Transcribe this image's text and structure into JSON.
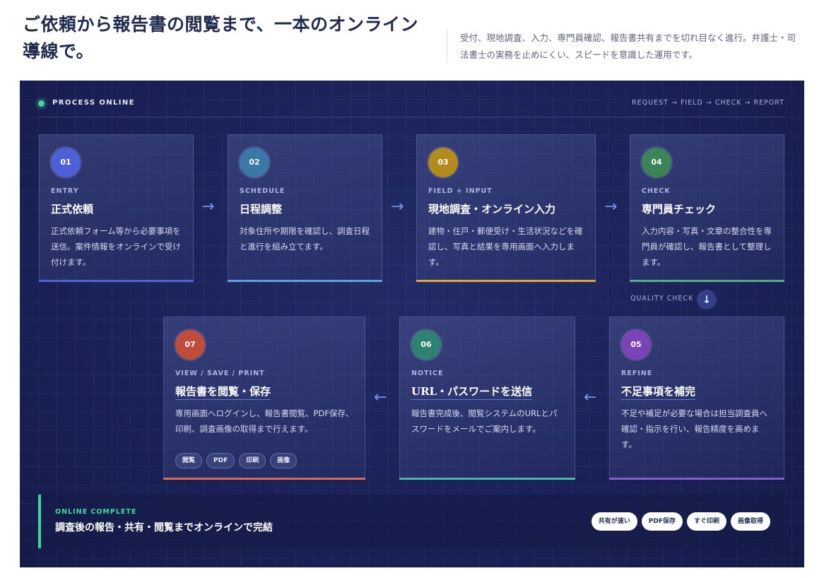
{
  "header": {
    "title": "ご依頼から報告書の閲覧まで、一本のオンライン導線で。",
    "description": "受付、現地調査、入力、専門員確認、報告書共有までを切れ目なく進行。弁護士・司法書士の実務を止めにくい、スピードを意識した運用です。"
  },
  "panel": {
    "label": "PROCESS ONLINE",
    "flow": "REQUEST → FIELD → CHECK → REPORT",
    "quality_check": "QUALITY CHECK",
    "arrow_right": "→",
    "arrow_left": "←",
    "arrow_down": "↓"
  },
  "steps": [
    {
      "num": "01",
      "tag": "ENTRY",
      "title": "正式依頼",
      "desc": "正式依頼フォーム等から必要事項を送信。案件情報をオンラインで受け付けます。",
      "color": "#4f5fd8"
    },
    {
      "num": "02",
      "tag": "SCHEDULE",
      "title": "日程調整",
      "desc": "対象住所や期限を確認し、調査日程と進行を組み立てます。",
      "color": "#3a78a8"
    },
    {
      "num": "03",
      "tag": "FIELD + INPUT",
      "title": "現地調査・オンライン入力",
      "desc": "建物・住戸・郵便受け・生活状況などを確認し、写真と結果を専用画面へ入力します。",
      "color": "#b38a1c"
    },
    {
      "num": "04",
      "tag": "CHECK",
      "title": "専門員チェック",
      "desc": "入力内容・写真・文章の整合性を専門員が確認し、報告書として整理します。",
      "color": "#3a8458"
    },
    {
      "num": "05",
      "tag": "REFINE",
      "title": "不足事項を補完",
      "desc": "不足や補足が必要な場合は担当調査員へ確認・指示を行い、報告精度を高めます。",
      "color": "#7a44b8"
    },
    {
      "num": "06",
      "tag": "NOTICE",
      "title": "URL・パスワードを送信",
      "desc": "報告書完成後、閲覧システムのURLとパスワードをメールでご案内します。",
      "color": "#2e8272"
    },
    {
      "num": "07",
      "tag": "VIEW / SAVE / PRINT",
      "title": "報告書を閲覧・保存",
      "desc": "専用画面へログインし、報告書閲覧、PDF保存、印刷、調査画像の取得まで行えます。",
      "color": "#c24c3c"
    }
  ],
  "bar_colors": [
    "#4f62d8",
    "#5aa4d8",
    "#e0a838",
    "#4fb088",
    "#8a5ad0",
    "#48b8a8",
    "#d86a58"
  ],
  "step7_chips": [
    "閲覧",
    "PDF",
    "印刷",
    "画像"
  ],
  "complete": {
    "tag": "ONLINE COMPLETE",
    "title": "調査後の報告・共有・閲覧までオンラインで完結",
    "pills": [
      "共有が速い",
      "PDF保存",
      "すぐ印刷",
      "画像取得"
    ]
  }
}
